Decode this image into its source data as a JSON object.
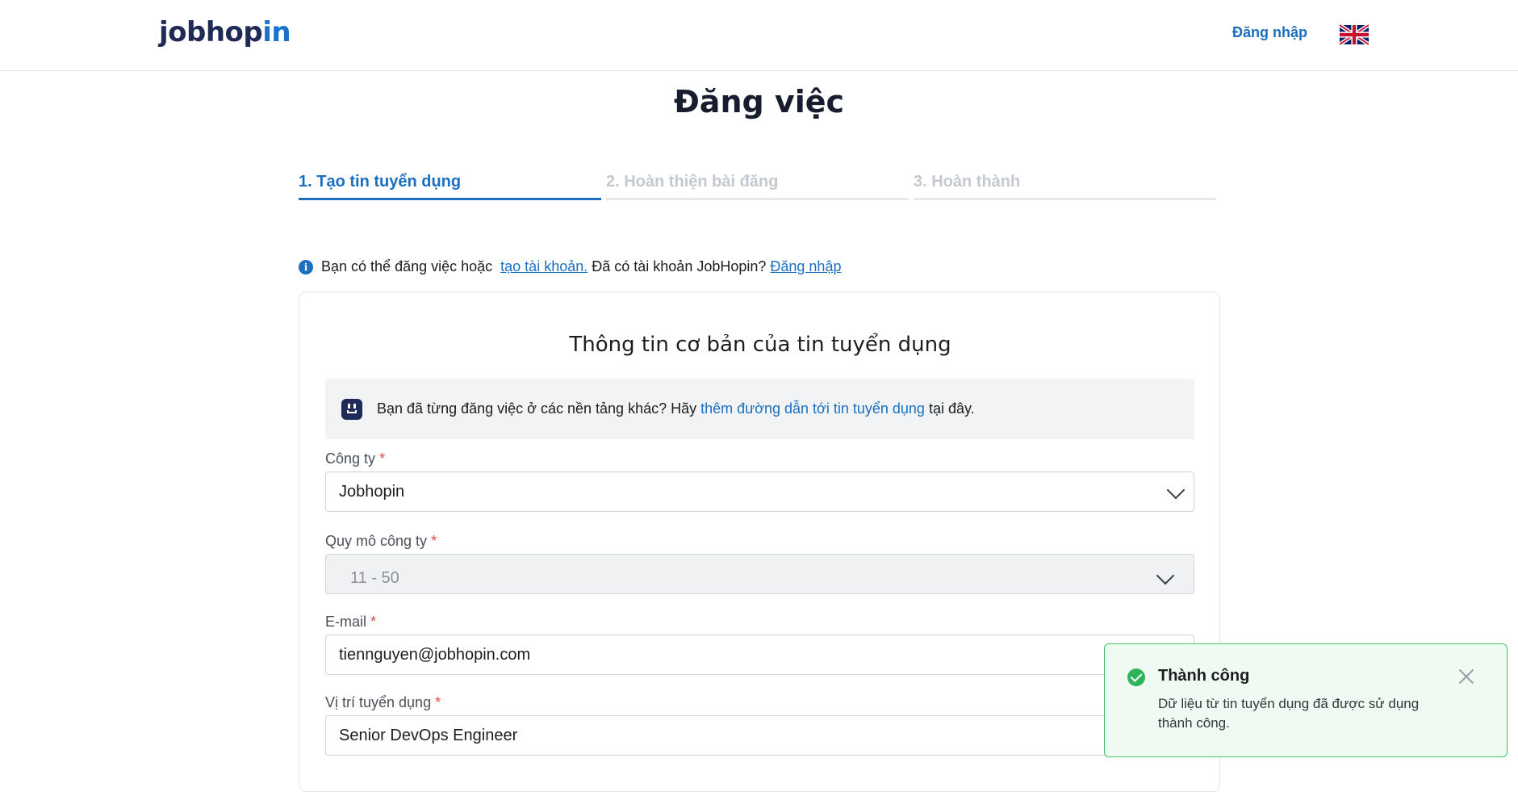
{
  "header": {
    "logo_prefix": "jobhop",
    "logo_suffix": "in",
    "login_label": "Đăng nhập",
    "language_icon": "uk-flag-icon"
  },
  "page": {
    "title": "Đăng việc"
  },
  "steps": [
    {
      "label": "1. Tạo tin tuyển dụng",
      "active": true
    },
    {
      "label": "2. Hoàn thiện bài đăng",
      "active": false
    },
    {
      "label": "3. Hoàn thành",
      "active": false
    }
  ],
  "info": {
    "text_before": "Bạn có thể đăng việc hoặc",
    "create_account_link": "tạo tài khoản.",
    "text_middle": "Đã có tài khoản JobHopin?",
    "login_link": "Đăng nhập"
  },
  "card": {
    "title": "Thông tin cơ bản của tin tuyển dụng",
    "notice_before": "Bạn đã từng đăng việc ở các nền tảng khác? Hãy",
    "notice_link": "thêm đường dẫn tới tin tuyển dụng",
    "notice_after": "tại đây.",
    "fields": {
      "company": {
        "label": "Công ty",
        "required": "*",
        "value": "Jobhopin"
      },
      "company_size": {
        "label": "Quy mô công ty",
        "required": "*",
        "value": "11 - 50"
      },
      "email": {
        "label": "E-mail",
        "required": "*",
        "value": "tiennguyen@jobhopin.com"
      },
      "position": {
        "label": "Vị trí tuyển dụng",
        "required": "*",
        "value": "Senior DevOps Engineer"
      }
    }
  },
  "toast": {
    "title": "Thành công",
    "message": "Dữ liệu từ tin tuyển dụng đã được sử dụng thành công."
  },
  "colors": {
    "primary": "#1b6fbf",
    "brand_dark": "#1f2a56",
    "success": "#2fb45a",
    "required": "#e04545"
  }
}
